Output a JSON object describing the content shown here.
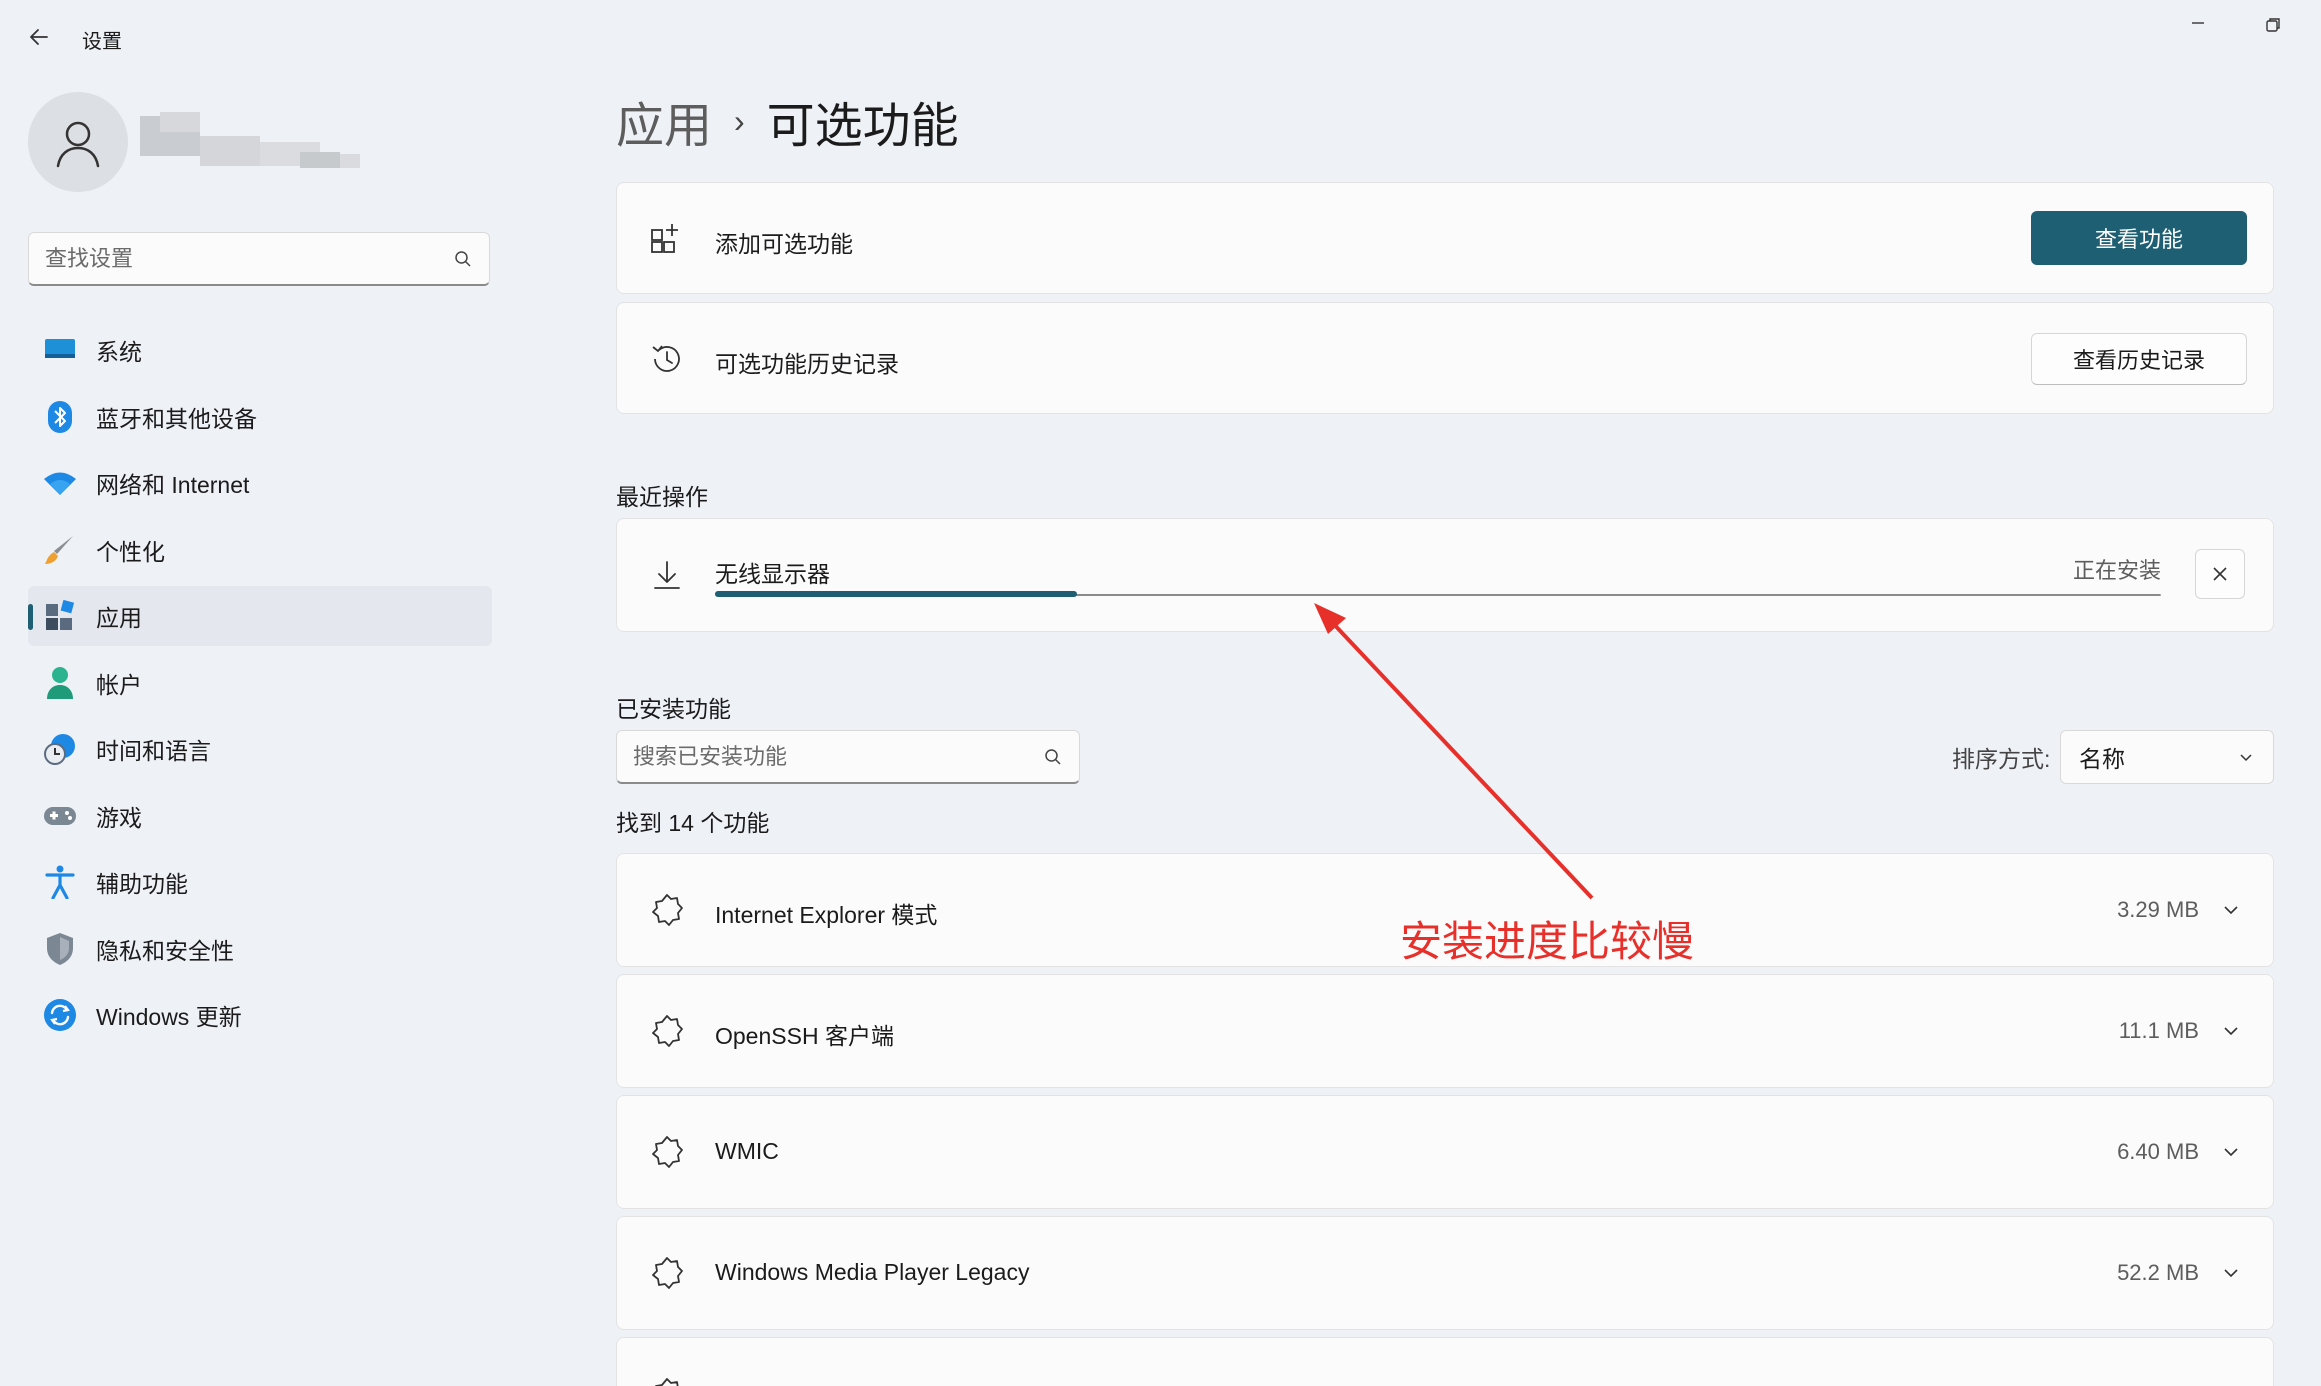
{
  "window": {
    "title": "设置"
  },
  "search": {
    "placeholder": "查找设置"
  },
  "sidebar": {
    "items": [
      {
        "label": "系统",
        "icon": "monitor-icon"
      },
      {
        "label": "蓝牙和其他设备",
        "icon": "bluetooth-icon"
      },
      {
        "label": "网络和 Internet",
        "icon": "wifi-icon"
      },
      {
        "label": "个性化",
        "icon": "brush-icon"
      },
      {
        "label": "应用",
        "icon": "apps-icon",
        "active": true
      },
      {
        "label": "帐户",
        "icon": "account-icon"
      },
      {
        "label": "时间和语言",
        "icon": "clock-globe-icon"
      },
      {
        "label": "游戏",
        "icon": "gamepad-icon"
      },
      {
        "label": "辅助功能",
        "icon": "accessibility-icon"
      },
      {
        "label": "隐私和安全性",
        "icon": "shield-icon"
      },
      {
        "label": "Windows 更新",
        "icon": "update-icon"
      }
    ]
  },
  "breadcrumb": {
    "parent": "应用",
    "separator": "›",
    "current": "可选功能"
  },
  "add_card": {
    "label": "添加可选功能",
    "button": "查看功能",
    "icon": "add-apps-icon"
  },
  "history_card": {
    "label": "可选功能历史记录",
    "button": "查看历史记录",
    "icon": "history-icon"
  },
  "recent": {
    "title": "最近操作",
    "item": {
      "name": "无线显示器",
      "status": "正在安装",
      "progress": 0.25,
      "icon": "download-icon"
    }
  },
  "installed": {
    "title": "已安装功能",
    "search_placeholder": "搜索已安装功能",
    "sort_label": "排序方式:",
    "sort_value": "名称",
    "found": "找到 14 个功能",
    "features": [
      {
        "name": "Internet Explorer 模式",
        "size": "3.29 MB"
      },
      {
        "name": "OpenSSH 客户端",
        "size": "11.1 MB"
      },
      {
        "name": "WMIC",
        "size": "6.40 MB"
      },
      {
        "name": "Windows Media Player Legacy",
        "size": "52.2 MB"
      }
    ]
  },
  "annotation": {
    "text": "安装进度比较慢",
    "color": "#e8302b"
  },
  "colors": {
    "accent": "#1f5f73",
    "background": "#eef2f7",
    "card": "#fbfbfc"
  }
}
